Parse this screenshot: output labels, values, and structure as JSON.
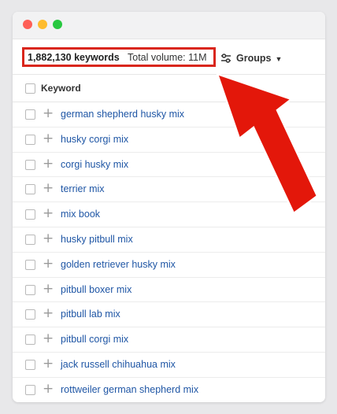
{
  "summary": {
    "keyword_count": "1,882,130 keywords",
    "total_volume": "Total volume: 11M"
  },
  "toolbar": {
    "groups_label": "Groups",
    "groups_caret": "▼"
  },
  "table": {
    "column_header": "Keyword",
    "rows": [
      {
        "plus": "+",
        "keyword": "german shepherd husky mix"
      },
      {
        "plus": "+",
        "keyword": "husky corgi mix"
      },
      {
        "plus": "+",
        "keyword": "corgi husky mix"
      },
      {
        "plus": "+",
        "keyword": "terrier mix"
      },
      {
        "plus": "+",
        "keyword": "mix book"
      },
      {
        "plus": "+",
        "keyword": "husky pitbull mix"
      },
      {
        "plus": "+",
        "keyword": "golden retriever husky mix"
      },
      {
        "plus": "+",
        "keyword": "pitbull boxer mix"
      },
      {
        "plus": "+",
        "keyword": "pitbull lab mix"
      },
      {
        "plus": "+",
        "keyword": "pitbull corgi mix"
      },
      {
        "plus": "+",
        "keyword": "jack russell chihuahua mix"
      },
      {
        "plus": "+",
        "keyword": "rottweiler german shepherd mix"
      }
    ]
  },
  "colors": {
    "highlight_red": "#d9261c",
    "link_blue": "#1f56a5",
    "arrow_red": "#e3170a"
  },
  "icons": {
    "window_controls": [
      "close-icon",
      "minimize-icon",
      "zoom-icon"
    ],
    "groups": "sliders-icon",
    "annotation": "arrow-icon"
  }
}
